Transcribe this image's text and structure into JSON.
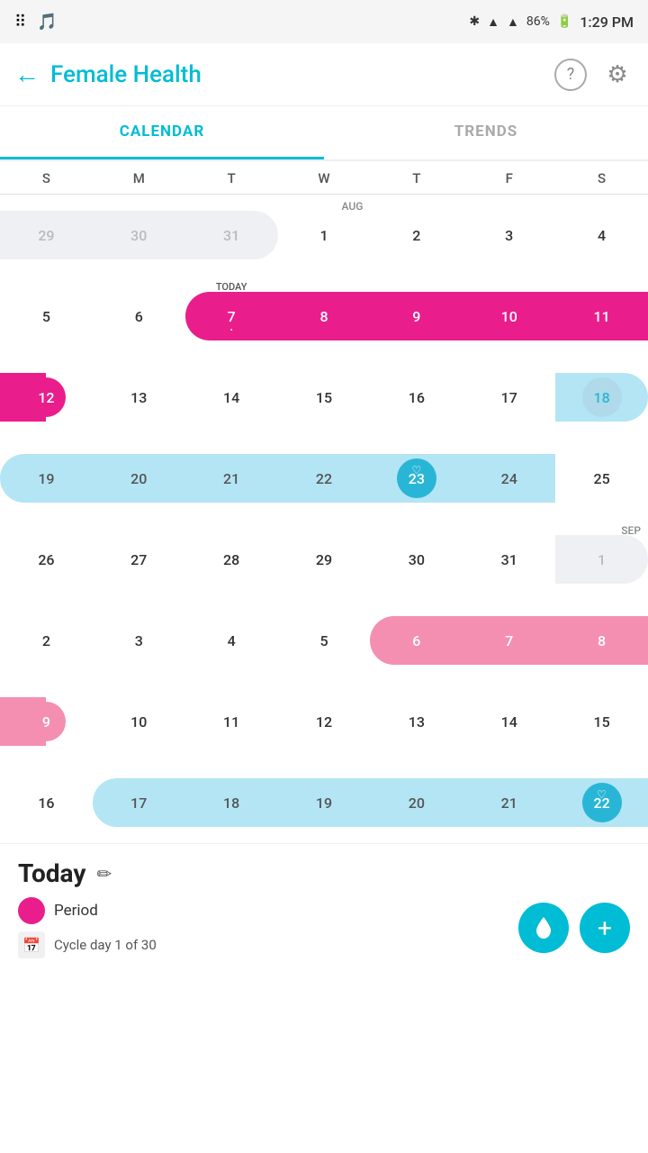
{
  "statusBar": {
    "time": "1:29 PM",
    "battery": "86%",
    "icons": [
      "bluetooth",
      "wifi",
      "signal"
    ]
  },
  "header": {
    "title": "Female Health",
    "back": "←"
  },
  "tabs": {
    "calendar": "CALENDAR",
    "trends": "TRENDS"
  },
  "dow": [
    "S",
    "M",
    "T",
    "W",
    "T",
    "F",
    "S"
  ],
  "todayLabel": "TODAY",
  "monthLabels": {
    "aug": "AUG",
    "sep": "SEP"
  },
  "weeks": [
    [
      "29",
      "30",
      "31",
      "1",
      "2",
      "3",
      "4"
    ],
    [
      "5",
      "6",
      "7",
      "8",
      "9",
      "10",
      "11"
    ],
    [
      "12",
      "13",
      "14",
      "15",
      "16",
      "17",
      "18"
    ],
    [
      "19",
      "20",
      "21",
      "22",
      "23",
      "24",
      "25"
    ],
    [
      "26",
      "27",
      "28",
      "29",
      "30",
      "31",
      "1"
    ],
    [
      "2",
      "3",
      "4",
      "5",
      "6",
      "7",
      "8"
    ],
    [
      "9",
      "10",
      "11",
      "12",
      "13",
      "14",
      "15"
    ],
    [
      "16",
      "17",
      "18",
      "19",
      "20",
      "21",
      "22"
    ]
  ],
  "bottom": {
    "todayText": "Today",
    "editIcon": "✏",
    "periodLabel": "Period",
    "cycleText": "Cycle day 1 of 30"
  },
  "fab": {
    "dropIcon": "💧",
    "plusIcon": "+"
  }
}
